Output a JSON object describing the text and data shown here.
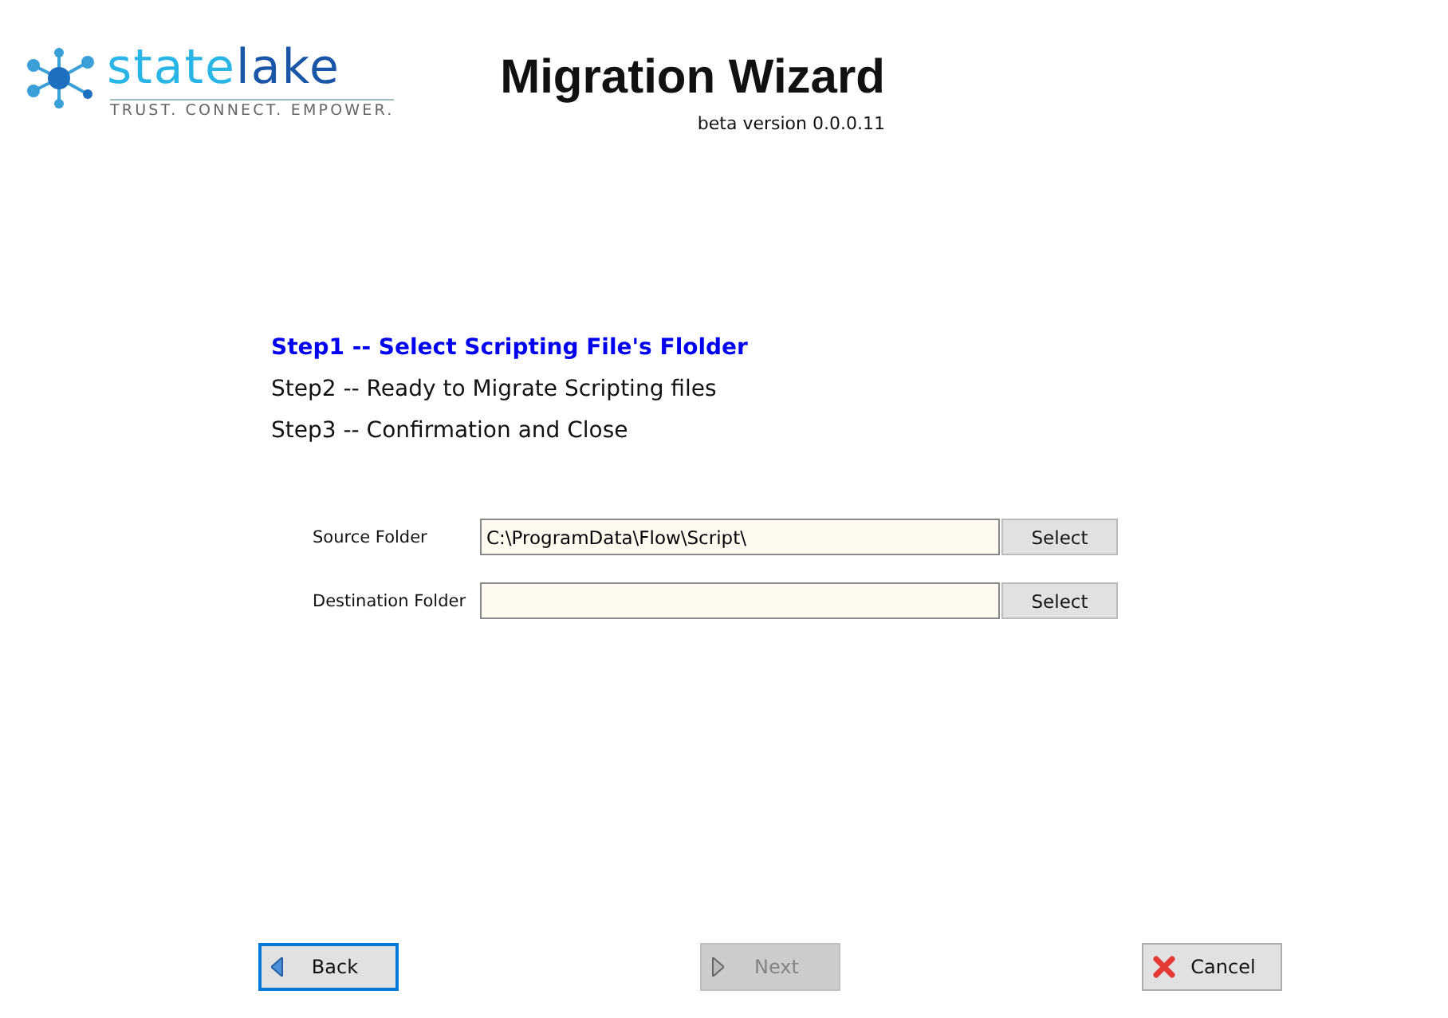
{
  "logo": {
    "name_first": "state",
    "name_second": "lake",
    "tagline": "TRUST. CONNECT. EMPOWER."
  },
  "title": "Migration Wizard",
  "version": "beta version 0.0.0.11",
  "steps": [
    {
      "label": "Step1 -- Select Scripting File's Flolder",
      "selected": true
    },
    {
      "label": "Step2 -- Ready to Migrate Scripting files",
      "selected": false
    },
    {
      "label": "Step3 -- Confirmation and Close",
      "selected": false
    }
  ],
  "fields": [
    {
      "label": "Source Folder",
      "value": "C:\\ProgramData\\Flow\\Script\\",
      "button": "Select"
    },
    {
      "label": "Destination Folder",
      "button": "Select"
    }
  ],
  "nav_buttons": [
    {
      "kind": "back",
      "label": "Back",
      "focused": true,
      "disabled": false
    },
    {
      "kind": "next",
      "label": "Next",
      "focused": false,
      "disabled": true
    },
    {
      "kind": "cancel",
      "label": "Cancel",
      "focused": false,
      "disabled": false
    }
  ]
}
